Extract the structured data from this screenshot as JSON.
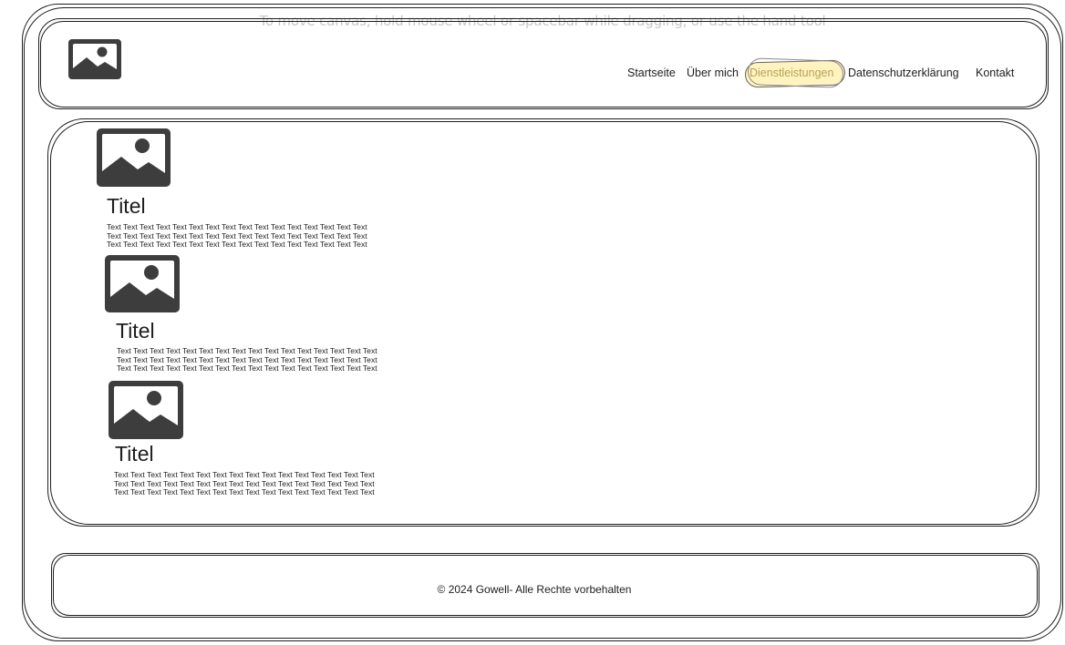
{
  "canvas_hint": "To move canvas, hold mouse wheel or spacebar while dragging, or use the hand tool",
  "header": {
    "logo_icon": "image-placeholder-icon",
    "nav": [
      {
        "label": "Startseite",
        "active": false
      },
      {
        "label": "Über mich",
        "active": false
      },
      {
        "label": "Dienstleistungen",
        "active": true
      },
      {
        "label": "Datenschutzerklärung",
        "active": false
      },
      {
        "label": "Kontakt",
        "active": false
      }
    ],
    "highlight_color": "#fff3bf"
  },
  "cards": [
    {
      "icon": "image-placeholder-icon",
      "title": "Titel",
      "lines": [
        "Text Text Text Text Text Text Text Text Text Text Text Text Text Text Text Text",
        "Text Text Text Text Text Text Text Text Text Text Text Text Text Text Text Text",
        "Text Text Text Text Text Text Text Text Text Text Text Text Text Text Text Text"
      ]
    },
    {
      "icon": "image-placeholder-icon",
      "title": "Titel",
      "lines": [
        "Text Text Text Text Text Text Text Text Text Text Text Text Text Text Text Text",
        "Text Text Text Text Text Text Text Text Text Text Text Text Text Text Text Text",
        "Text Text Text Text Text Text Text Text Text Text Text Text Text Text Text Text"
      ]
    },
    {
      "icon": "image-placeholder-icon",
      "title": "Titel",
      "lines": [
        "Text Text Text Text Text Text Text Text Text Text Text Text Text Text Text Text",
        "Text Text Text Text Text Text Text Text Text Text Text Text Text Text Text Text",
        "Text Text Text Text Text Text Text Text Text Text Text Text Text Text Text Text"
      ]
    }
  ],
  "footer": {
    "text": "© 2024 Gowell- Alle Rechte vorbehalten"
  },
  "colors": {
    "stroke": "#1e1e1e",
    "icon_fill": "#3d3d3d",
    "hint_text": "#c8c8c8"
  }
}
